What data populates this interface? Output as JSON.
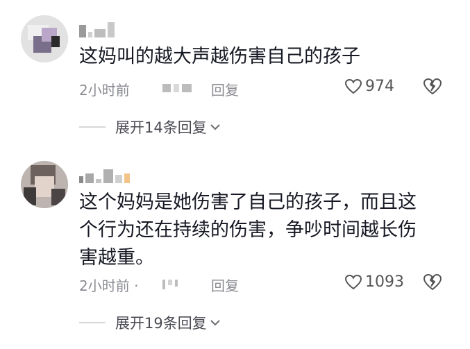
{
  "comments": [
    {
      "text": "这妈叫的越大声越伤害自己的孩子",
      "time": "2小时前",
      "reply_label": "回复",
      "likes": "974",
      "expand_label": "展开14条回复"
    },
    {
      "text": "这个妈妈是她伤害了自己的孩子，而且这\n个行为还在持续的伤害，争吵时间越长伤\n害越重。",
      "time": "2小时前 ·",
      "reply_label": "回复",
      "likes": "1093",
      "expand_label": "展开19条回复"
    }
  ],
  "icons": {
    "like": "heart-outline-icon",
    "dislike": "broken-heart-icon",
    "expand": "chevron-down-icon"
  }
}
